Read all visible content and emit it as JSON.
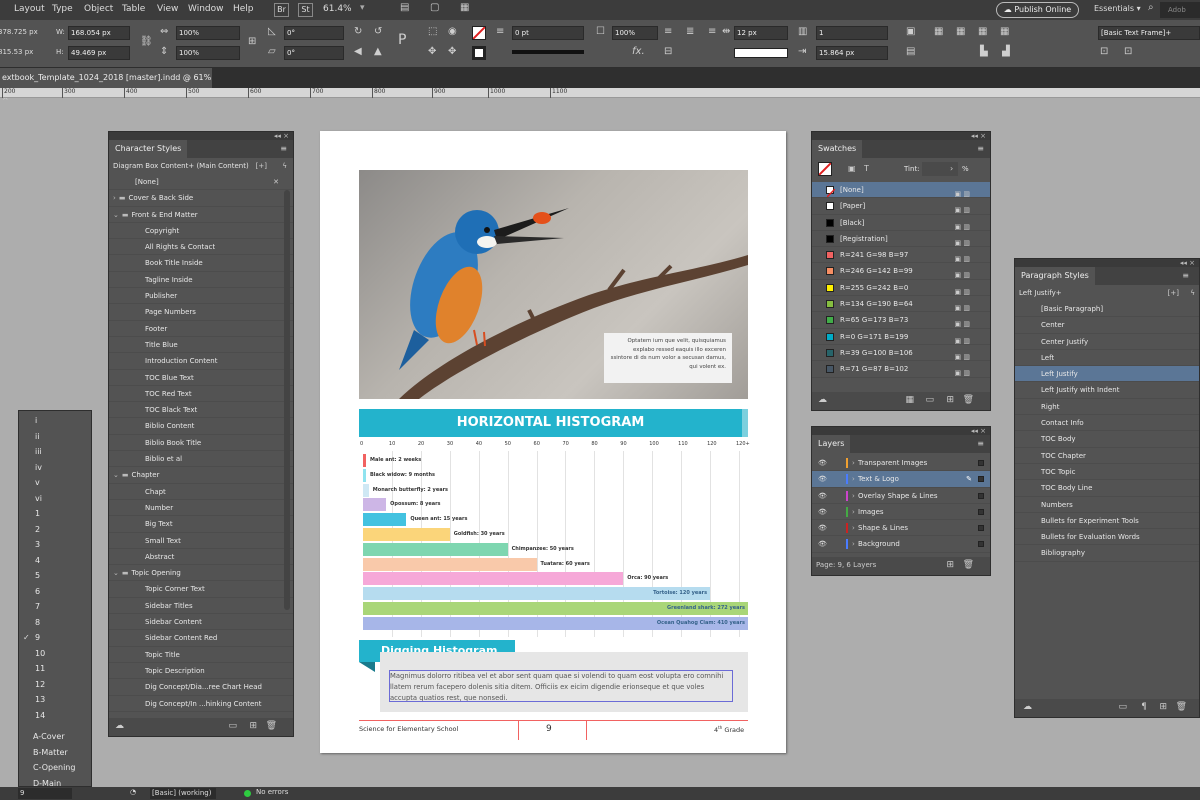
{
  "menu": [
    "Layout",
    "Type",
    "Object",
    "Table",
    "View",
    "Window",
    "Help"
  ],
  "app_buttons": {
    "br": "Br",
    "st": "St"
  },
  "zoom": "61.4%",
  "publish_label": "Publish Online",
  "workspace": "Essentials",
  "search_partial": "Adob",
  "control": {
    "x": "378.725 px",
    "y": "815.53 px",
    "w": "168.054 px",
    "h": "49.469 px",
    "scale_x": "100%",
    "scale_y": "100%",
    "rotate": "0°",
    "shear": "0°",
    "stroke_weight": "0 pt",
    "opacity": "100%",
    "gutter": "12 px",
    "columns": "1",
    "stroke_px": "15.864 px",
    "style": "[Basic Text Frame]+"
  },
  "doc_tab": "extbook_Template_1024_2018 [master].indd @ 61%",
  "ruler_ticks": [
    "200",
    "300",
    "400",
    "500",
    "600",
    "700",
    "800",
    "900",
    "1000",
    "1100"
  ],
  "left_pages": {
    "items": [
      "i",
      "ii",
      "iii",
      "iv",
      "v",
      "vi",
      "1",
      "2",
      "3",
      "4",
      "5",
      "6",
      "7",
      "8",
      "9",
      "10",
      "11",
      "12",
      "13",
      "14"
    ],
    "masters": [
      "A-Cover",
      "B-Matter",
      "C-Opening",
      "D-Main"
    ],
    "checked_index": 14
  },
  "char_styles": {
    "title": "Character Styles",
    "current": "Diagram Box Content+ (Main Content)",
    "rows": [
      {
        "label": "[None]",
        "indent": 1,
        "folder": false,
        "open": false
      },
      {
        "label": "Cover & Back Side",
        "indent": 0,
        "folder": true,
        "open": false
      },
      {
        "label": "Front & End Matter",
        "indent": 0,
        "folder": true,
        "open": true
      },
      {
        "label": "Copyright",
        "indent": 2,
        "folder": false
      },
      {
        "label": "All Rights & Contact",
        "indent": 2,
        "folder": false
      },
      {
        "label": "Book Title Inside",
        "indent": 2,
        "folder": false
      },
      {
        "label": "Tagline Inside",
        "indent": 2,
        "folder": false
      },
      {
        "label": "Publisher",
        "indent": 2,
        "folder": false
      },
      {
        "label": "Page Numbers",
        "indent": 2,
        "folder": false
      },
      {
        "label": "Footer",
        "indent": 2,
        "folder": false
      },
      {
        "label": "Title Blue",
        "indent": 2,
        "folder": false
      },
      {
        "label": "Introduction Content",
        "indent": 2,
        "folder": false
      },
      {
        "label": "TOC Blue Text",
        "indent": 2,
        "folder": false
      },
      {
        "label": "TOC Red Text",
        "indent": 2,
        "folder": false
      },
      {
        "label": "TOC Black Text",
        "indent": 2,
        "folder": false
      },
      {
        "label": "Biblio Content",
        "indent": 2,
        "folder": false
      },
      {
        "label": "Biblio Book Title",
        "indent": 2,
        "folder": false
      },
      {
        "label": "Biblio et al",
        "indent": 2,
        "folder": false
      },
      {
        "label": "Chapter",
        "indent": 0,
        "folder": true,
        "open": true
      },
      {
        "label": "Chapt",
        "indent": 2,
        "folder": false
      },
      {
        "label": "Number",
        "indent": 2,
        "folder": false
      },
      {
        "label": "Big Text",
        "indent": 2,
        "folder": false
      },
      {
        "label": "Small Text",
        "indent": 2,
        "folder": false
      },
      {
        "label": "Abstract",
        "indent": 2,
        "folder": false
      },
      {
        "label": "Topic Opening",
        "indent": 0,
        "folder": true,
        "open": true
      },
      {
        "label": "Topic Corner Text",
        "indent": 2,
        "folder": false
      },
      {
        "label": "Sidebar Titles",
        "indent": 2,
        "folder": false
      },
      {
        "label": "Sidebar Content",
        "indent": 2,
        "folder": false
      },
      {
        "label": "Sidebar Content Red",
        "indent": 2,
        "folder": false
      },
      {
        "label": "Topic Title",
        "indent": 2,
        "folder": false
      },
      {
        "label": "Topic Description",
        "indent": 2,
        "folder": false
      },
      {
        "label": "Dig Concept/Dia...ree Chart Head",
        "indent": 2,
        "folder": false
      },
      {
        "label": "Dig Concept/In ...hinking Content",
        "indent": 2,
        "folder": false
      }
    ]
  },
  "swatches": {
    "title": "Swatches",
    "tint_label": "Tint:",
    "tint_unit": "%",
    "rows": [
      {
        "label": "[None]",
        "color": "none",
        "selected": true
      },
      {
        "label": "[Paper]",
        "color": "#ffffff"
      },
      {
        "label": "[Black]",
        "color": "#000000"
      },
      {
        "label": "[Registration]",
        "color": "#000000"
      },
      {
        "label": "R=241 G=98 B=97",
        "color": "#f16261"
      },
      {
        "label": "R=246 G=142 B=99",
        "color": "#f68e63"
      },
      {
        "label": "R=255 G=242 B=0",
        "color": "#fff200"
      },
      {
        "label": "R=134 G=190 B=64",
        "color": "#86be40"
      },
      {
        "label": "R=65 G=173 B=73",
        "color": "#41ad49"
      },
      {
        "label": "R=0 G=171 B=199",
        "color": "#00abc7"
      },
      {
        "label": "R=39 G=100 B=106",
        "color": "#27646a"
      },
      {
        "label": "R=71 G=87 B=102",
        "color": "#475766"
      }
    ]
  },
  "layers": {
    "title": "Layers",
    "rows": [
      {
        "label": "Transparent Images",
        "color": "#f0a030",
        "selected": false
      },
      {
        "label": "Text & Logo",
        "color": "#4a7cff",
        "selected": true
      },
      {
        "label": "Overlay Shape & Lines",
        "color": "#cc44cc",
        "selected": false
      },
      {
        "label": "Images",
        "color": "#44aa44",
        "selected": false
      },
      {
        "label": "Shape & Lines",
        "color": "#cc2222",
        "selected": false
      },
      {
        "label": "Background",
        "color": "#4a7cff",
        "selected": false
      }
    ],
    "footer": "Page: 9, 6 Layers"
  },
  "para_styles": {
    "title": "Paragraph Styles",
    "current": "Left Justify+",
    "rows": [
      "[Basic Paragraph]",
      "Center",
      "Center Justify",
      "Left",
      "Left Justify",
      "Left Justify with Indent",
      "Right",
      "Contact Info",
      "TOC Body",
      "TOC Chapter",
      "TOC Topic",
      "TOC Body Line",
      "Numbers",
      "Bullets for Experiment Tools",
      "Bullets for Evaluation Words",
      "Bibliography"
    ],
    "selected_index": 4
  },
  "page": {
    "caption": "Optatem ium que velit, quisquiamus explabo ressed eaquis illo exceren ssintore di ds num volor a secusan damus, qui volent ex.",
    "histogram_title": "HORIZONTAL HISTOGRAM",
    "digging_title": "Digging Histogram",
    "digging_text": "Magnimus dolorro ritibea vel et abor sent quam quae si volendi to quam eost volupta ero comnihi llatem rerum facepero dolenis sitia ditem. Officiis ex eicim digendie erionseque et que voles accupta quatios rest, que nonsedi.",
    "footer_left": "Science for Elementary School",
    "footer_page": "9",
    "footer_right_num": "4",
    "footer_right_sup": "th",
    "footer_right_text": " Grade"
  },
  "chart_data": {
    "type": "bar",
    "orientation": "horizontal",
    "title": "HORIZONTAL HISTOGRAM",
    "x_ticks": [
      "0",
      "10",
      "20",
      "30",
      "40",
      "50",
      "60",
      "70",
      "80",
      "90",
      "100",
      "110",
      "120",
      "120+"
    ],
    "xlim": [
      0,
      125
    ],
    "categories": [
      "Male ant",
      "Black widow",
      "Monarch butterfly",
      "Opossum",
      "Queen ant",
      "Goldfish",
      "Chimpanzee",
      "Tuatara",
      "Orca",
      "Tortoise",
      "Greenland shark",
      "Ocean Quahog Clam"
    ],
    "labels": [
      "Male ant: 2 weeks",
      "Black widow: 9 months",
      "Monarch butterfly: 2 years",
      "Opossum: 8 years",
      "Queen ant: 15 years",
      "Goldfish: 30 years",
      "Chimpanzee: 50 years",
      "Tuatara: 60 years",
      "Orca: 90 years",
      "Tortoise: 120 years",
      "Greenland shark: 272 years",
      "Ocean Quahog Clam: 410 years"
    ],
    "values": [
      0.04,
      0.75,
      2,
      8,
      15,
      30,
      50,
      60,
      90,
      120,
      272,
      410
    ],
    "colors": [
      "#f16261",
      "#8fe3ef",
      "#cfe8f4",
      "#cdb6e6",
      "#43c2e0",
      "#fbd57a",
      "#7ed6b0",
      "#f9c9aa",
      "#f6a8d8",
      "#b6dcef",
      "#a9d678",
      "#a7b6e8"
    ]
  }
}
